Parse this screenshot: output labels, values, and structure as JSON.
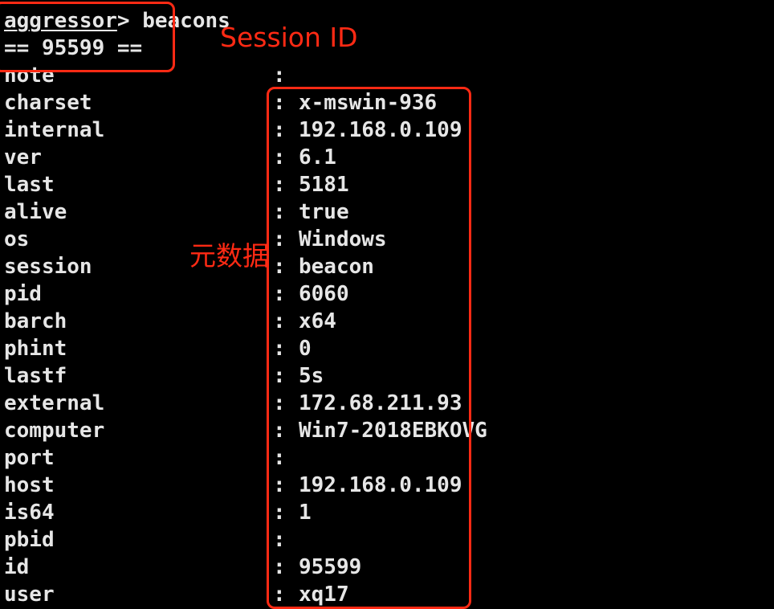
{
  "terminal": {
    "prompt_user": "aggressor",
    "prompt_symbol": ">",
    "command": "beacons",
    "session_header": "== 95599 ==",
    "fields": [
      {
        "key": "note",
        "value": ""
      },
      {
        "key": "charset",
        "value": "x-mswin-936"
      },
      {
        "key": "internal",
        "value": "192.168.0.109"
      },
      {
        "key": "ver",
        "value": "6.1"
      },
      {
        "key": "last",
        "value": "5181"
      },
      {
        "key": "alive",
        "value": "true"
      },
      {
        "key": "os",
        "value": "Windows"
      },
      {
        "key": "session",
        "value": "beacon"
      },
      {
        "key": "pid",
        "value": "6060"
      },
      {
        "key": "barch",
        "value": "x64"
      },
      {
        "key": "phint",
        "value": "0"
      },
      {
        "key": "lastf",
        "value": "5s"
      },
      {
        "key": "external",
        "value": "172.68.211.93"
      },
      {
        "key": "computer",
        "value": "Win7-2018EBKOVG"
      },
      {
        "key": "port",
        "value": ""
      },
      {
        "key": "host",
        "value": "192.168.0.109"
      },
      {
        "key": "is64",
        "value": "1"
      },
      {
        "key": "pbid",
        "value": ""
      },
      {
        "key": "id",
        "value": "95599"
      },
      {
        "key": "user",
        "value": "xq17"
      }
    ],
    "separator": ":"
  },
  "annotations": {
    "session_id_label": "Session ID",
    "metadata_label": "元数据",
    "color": "#ff2a14"
  }
}
